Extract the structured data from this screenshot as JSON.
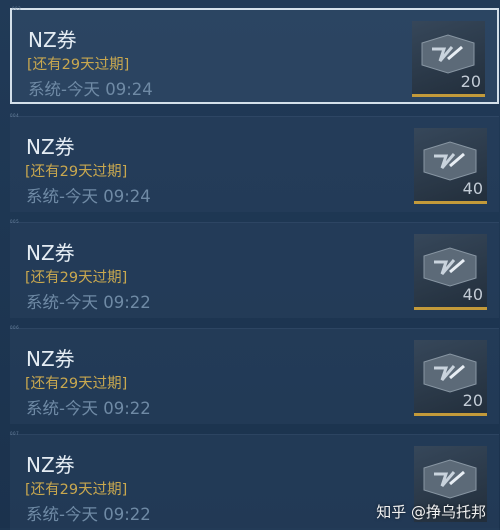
{
  "items": [
    {
      "id": "003",
      "title": "NZ券",
      "expiry": "[还有29天过期]",
      "meta": "系统-今天 09:24",
      "count": "20",
      "selected": true
    },
    {
      "id": "004",
      "title": "NZ券",
      "expiry": "[还有29天过期]",
      "meta": "系统-今天 09:24",
      "count": "40",
      "selected": false
    },
    {
      "id": "005",
      "title": "NZ券",
      "expiry": "[还有29天过期]",
      "meta": "系统-今天 09:22",
      "count": "40",
      "selected": false
    },
    {
      "id": "006",
      "title": "NZ券",
      "expiry": "[还有29天过期]",
      "meta": "系统-今天 09:22",
      "count": "20",
      "selected": false
    },
    {
      "id": "007",
      "title": "NZ券",
      "expiry": "[还有29天过期]",
      "meta": "系统-今天 09:22",
      "count": "",
      "selected": false
    }
  ],
  "watermark": "知乎 @挣乌托邦",
  "icons": {
    "ticket": "nz-ticket-icon"
  },
  "colors": {
    "accent": "#c9a84f",
    "selected_border": "#d4e0ea"
  }
}
